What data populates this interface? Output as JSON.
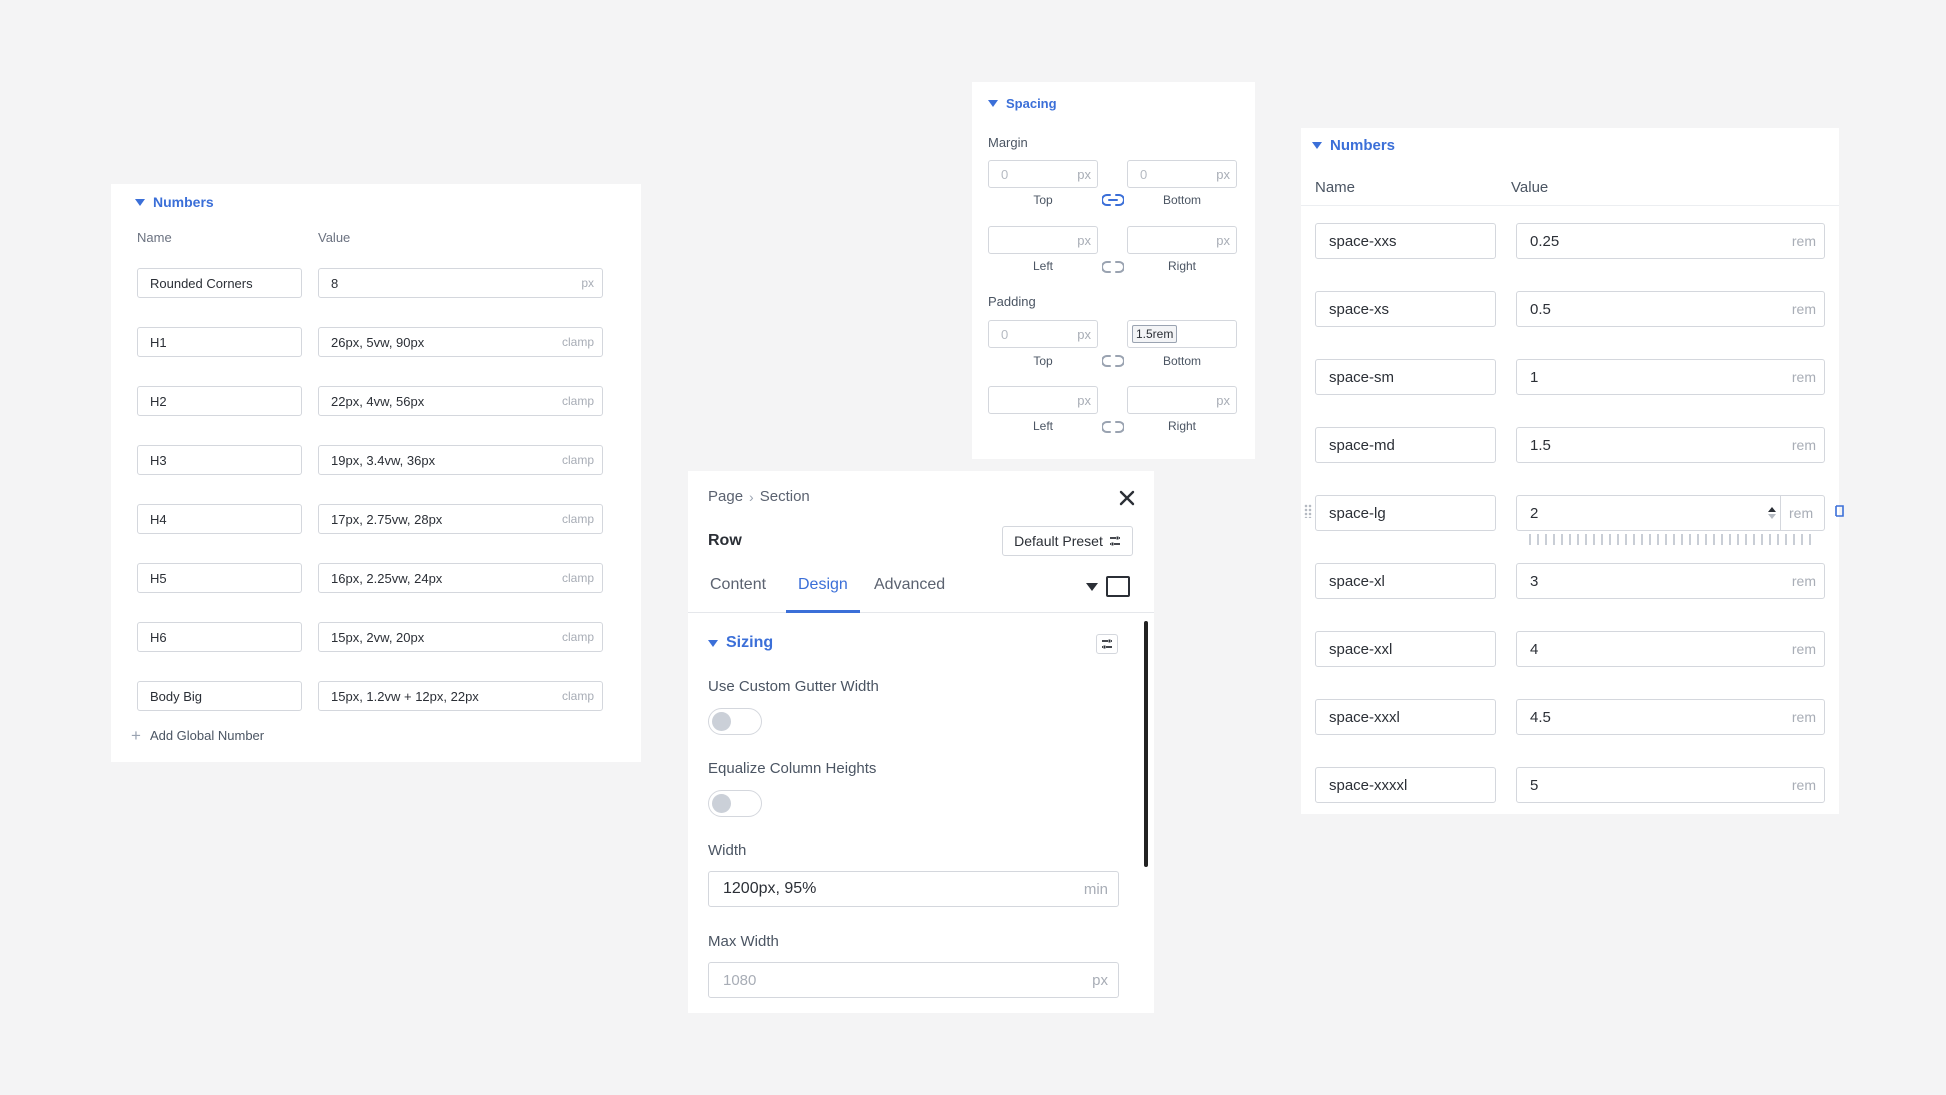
{
  "colors": {
    "accent": "#3b6fd8",
    "text": "#2b2f36",
    "muted": "#a8adb6",
    "border": "#d4d7dd"
  },
  "numbers_panel_left": {
    "section_title": "Numbers",
    "col_name": "Name",
    "col_value": "Value",
    "rows": [
      {
        "name": "Rounded Corners",
        "value": "8",
        "unit": "px"
      },
      {
        "name": "H1",
        "value": "26px, 5vw, 90px",
        "unit": "clamp"
      },
      {
        "name": "H2",
        "value": "22px, 4vw, 56px",
        "unit": "clamp"
      },
      {
        "name": "H3",
        "value": "19px, 3.4vw, 36px",
        "unit": "clamp"
      },
      {
        "name": "H4",
        "value": "17px, 2.75vw, 28px",
        "unit": "clamp"
      },
      {
        "name": "H5",
        "value": "16px, 2.25vw, 24px",
        "unit": "clamp"
      },
      {
        "name": "H6",
        "value": "15px, 2vw, 20px",
        "unit": "clamp"
      },
      {
        "name": "Body Big",
        "value": "15px, 1.2vw + 12px, 22px",
        "unit": "clamp"
      }
    ],
    "add_label": "Add Global Number"
  },
  "spacing_panel": {
    "section_title": "Spacing",
    "margin_label": "Margin",
    "padding_label": "Padding",
    "margin": {
      "top": {
        "placeholder": "0",
        "unit": "px",
        "label": "Top"
      },
      "bottom": {
        "placeholder": "0",
        "unit": "px",
        "label": "Bottom"
      },
      "left": {
        "placeholder": "",
        "unit": "px",
        "label": "Left"
      },
      "right": {
        "placeholder": "",
        "unit": "px",
        "label": "Right"
      }
    },
    "padding": {
      "top": {
        "placeholder": "0",
        "unit": "px",
        "label": "Top"
      },
      "bottom": {
        "value": "1.5rem",
        "label": "Bottom"
      },
      "left": {
        "placeholder": "",
        "unit": "px",
        "label": "Left"
      },
      "right": {
        "placeholder": "",
        "unit": "px",
        "label": "Right"
      }
    }
  },
  "row_panel": {
    "breadcrumb": [
      "Page",
      "Section"
    ],
    "breadcrumb_sep": "›",
    "title": "Row",
    "preset_label": "Default Preset",
    "tabs": [
      {
        "label": "Content",
        "active": false
      },
      {
        "label": "Design",
        "active": true
      },
      {
        "label": "Advanced",
        "active": false
      }
    ],
    "section_title": "Sizing",
    "gutter_label": "Use Custom Gutter Width",
    "gutter_on": false,
    "equalize_label": "Equalize Column Heights",
    "equalize_on": false,
    "width_label": "Width",
    "width_value": "1200px, 95%",
    "width_unit": "min",
    "max_width_label": "Max Width",
    "max_width_placeholder": "1080",
    "max_width_unit": "px"
  },
  "numbers_panel_right": {
    "section_title": "Numbers",
    "col_name": "Name",
    "col_value": "Value",
    "rows": [
      {
        "name": "space-xxs",
        "value": "0.25",
        "unit": "rem"
      },
      {
        "name": "space-xs",
        "value": "0.5",
        "unit": "rem"
      },
      {
        "name": "space-sm",
        "value": "1",
        "unit": "rem"
      },
      {
        "name": "space-md",
        "value": "1.5",
        "unit": "rem"
      },
      {
        "name": "space-lg",
        "value": "2",
        "unit": "rem"
      },
      {
        "name": "space-xl",
        "value": "3",
        "unit": "rem"
      },
      {
        "name": "space-xxl",
        "value": "4",
        "unit": "rem"
      },
      {
        "name": "space-xxxl",
        "value": "4.5",
        "unit": "rem"
      },
      {
        "name": "space-xxxxl",
        "value": "5",
        "unit": "rem"
      }
    ]
  }
}
